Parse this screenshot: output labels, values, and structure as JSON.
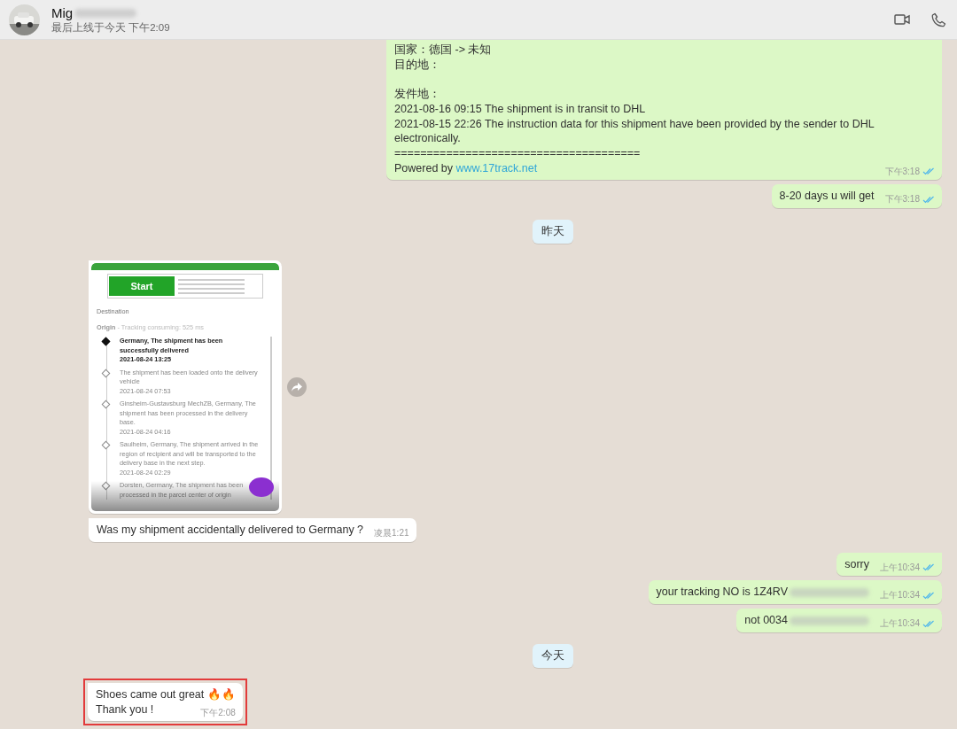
{
  "header": {
    "name": "Mig",
    "status": "最后上线于今天 下午2:09"
  },
  "messages": [
    {
      "kind": "outgoing",
      "paragraphs": [
        [
          "国家：德国 -> 未知",
          "目的地："
        ],
        [
          "发件地：",
          "2021-08-16 09:15 The shipment is in transit to DHL",
          "2021-08-15 22:26 The instruction data for this shipment have been provided by the sender to DHL electronically.",
          "======================================"
        ]
      ],
      "footer": {
        "text": "Powered by",
        "link": "www.17track.net"
      },
      "time": "下午3:18",
      "read": true
    },
    {
      "kind": "outgoing",
      "lines": [
        "8-20 days u will get"
      ],
      "time": "下午3:18",
      "read": true
    },
    {
      "kind": "date",
      "text": "昨天"
    },
    {
      "screenshot": {
        "ad_button": "Start",
        "destination_label": "Destination",
        "origin_label": "Origin",
        "origin_note": "- Tracking consuming: 525 ms",
        "events": [
          {
            "text": "Germany, The shipment has been successfully delivered",
            "time": "2021-08-24 13:25",
            "current": true
          },
          {
            "text": "The shipment has been loaded onto the delivery vehicle",
            "time": "2021-08-24 07:53",
            "current": false
          },
          {
            "text": "Ginsheim-Gustavsburg MechZB, Germany, The shipment has been processed in the delivery base.",
            "time": "2021-08-24 04:16",
            "current": false
          },
          {
            "text": "Saulheim, Germany, The shipment arrived in the region of recipient and will be transported to the delivery base in the next step.",
            "time": "2021-08-24 02:29",
            "current": false
          },
          {
            "text": "Dorsten, Germany, The shipment has been processed in the parcel center of origin",
            "current": false
          }
        ]
      }
    },
    {
      "kind": "incoming",
      "lines": [
        "Was my shipment accidentally delivered to Germany ?"
      ],
      "time": "凌晨1:21"
    },
    {
      "kind": "outgoing",
      "lines": [
        "sorry"
      ],
      "time": "上午10:34",
      "read": true
    },
    {
      "kind": "outgoing",
      "lines": [
        "your tracking NO is 1Z4RV"
      ],
      "redacted": true,
      "time": "上午10:34",
      "read": true
    },
    {
      "kind": "outgoing",
      "lines": [
        "not 0034"
      ],
      "redacted": true,
      "time": "上午10:34",
      "read": true
    },
    {
      "kind": "date",
      "text": "今天"
    },
    {
      "kind": "incoming",
      "lines": [
        "Shoes came out great 🔥🔥",
        "Thank you !"
      ],
      "time": "下午2:08",
      "highlighted": true
    }
  ]
}
